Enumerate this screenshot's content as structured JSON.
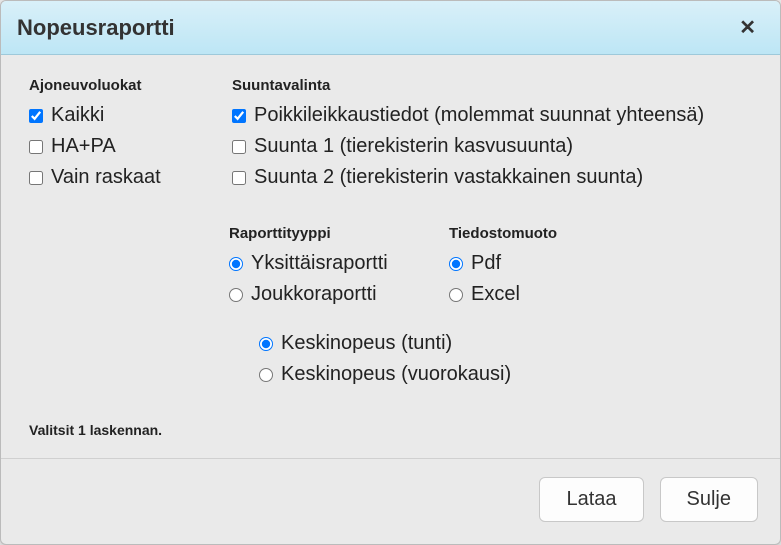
{
  "dialog": {
    "title": "Nopeusraportti"
  },
  "vehicle_classes": {
    "label": "Ajoneuvoluokat",
    "options": [
      {
        "label": "Kaikki",
        "checked": true
      },
      {
        "label": "HA+PA",
        "checked": false
      },
      {
        "label": "Vain raskaat",
        "checked": false
      }
    ]
  },
  "direction": {
    "label": "Suuntavalinta",
    "options": [
      {
        "label": "Poikkileikkaustiedot (molemmat suunnat yhteensä)",
        "checked": true
      },
      {
        "label": "Suunta 1 (tierekisterin kasvusuunta)",
        "checked": false
      },
      {
        "label": "Suunta 2 (tierekisterin vastakkainen suunta)",
        "checked": false
      }
    ]
  },
  "report_type": {
    "label": "Raporttityyppi",
    "options": [
      {
        "label": "Yksittäisraportti",
        "selected": true
      },
      {
        "label": "Joukkoraportti",
        "selected": false
      }
    ]
  },
  "file_format": {
    "label": "Tiedostomuoto",
    "options": [
      {
        "label": "Pdf",
        "selected": true
      },
      {
        "label": "Excel",
        "selected": false
      }
    ]
  },
  "speed_options": {
    "options": [
      {
        "label": "Keskinopeus (tunti)",
        "selected": true
      },
      {
        "label": "Keskinopeus (vuorokausi)",
        "selected": false
      }
    ]
  },
  "status": "Valitsit 1 laskennan.",
  "buttons": {
    "download": "Lataa",
    "close": "Sulje"
  }
}
